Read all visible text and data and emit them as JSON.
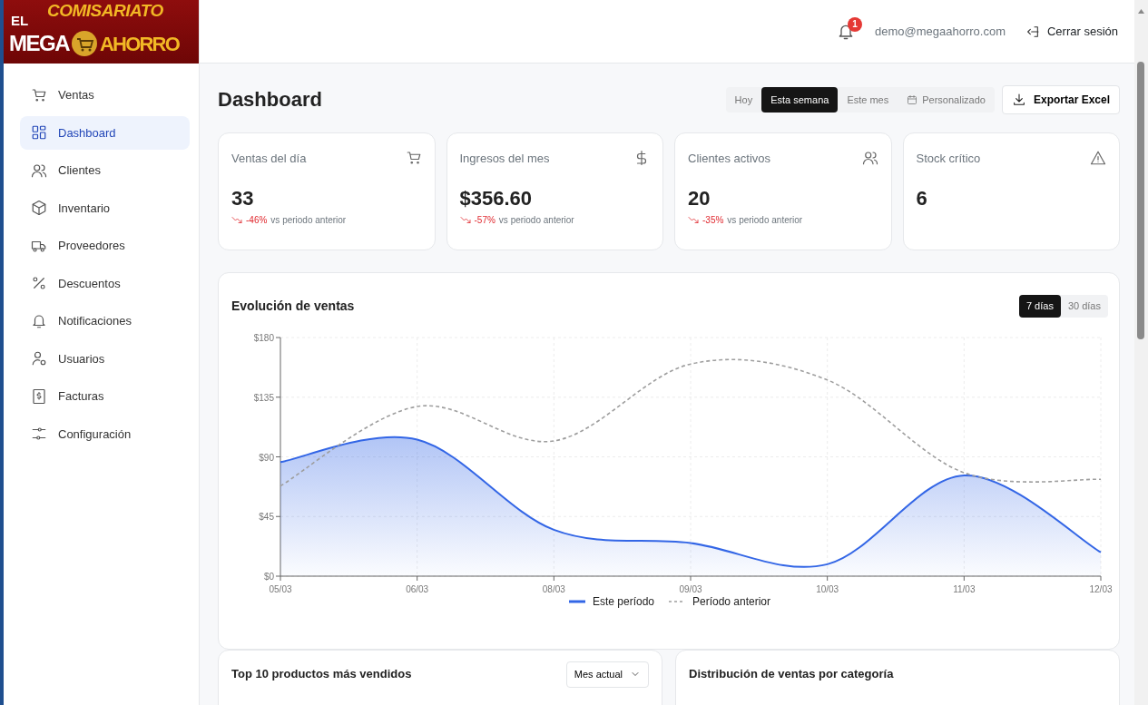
{
  "logo": {
    "texts": [
      "EL",
      "COMISARIATO",
      "MEGA",
      "AHORRO"
    ]
  },
  "header": {
    "notification_count": "1",
    "user_email": "demo@megaahorro.com",
    "logout": "Cerrar sesión"
  },
  "sidebar": {
    "items": [
      {
        "label": "Ventas",
        "selected": false
      },
      {
        "label": "Dashboard",
        "selected": true
      },
      {
        "label": "Clientes",
        "selected": false
      },
      {
        "label": "Inventario",
        "selected": false
      },
      {
        "label": "Proveedores",
        "selected": false
      },
      {
        "label": "Descuentos",
        "selected": false
      },
      {
        "label": "Notificaciones",
        "selected": false
      },
      {
        "label": "Usuarios",
        "selected": false
      },
      {
        "label": "Facturas",
        "selected": false
      },
      {
        "label": "Configuración",
        "selected": false
      }
    ]
  },
  "page": {
    "title": "Dashboard",
    "period_filters": [
      {
        "label": "Hoy",
        "selected": false
      },
      {
        "label": "Esta semana",
        "selected": true
      },
      {
        "label": "Este mes",
        "selected": false
      },
      {
        "label": "Personalizado",
        "selected": false
      }
    ],
    "export_button": "Exportar Excel"
  },
  "stat_cards": [
    {
      "title": "Ventas del día",
      "value": "33",
      "change": "-46%",
      "change_note": "vs periodo anterior"
    },
    {
      "title": "Ingresos del mes",
      "value": "$356.60",
      "change": "-57%",
      "change_note": "vs periodo anterior"
    },
    {
      "title": "Clientes activos",
      "value": "20",
      "change": "-35%",
      "change_note": "vs periodo anterior"
    },
    {
      "title": "Stock crítico",
      "value": "6"
    }
  ],
  "sales_chart": {
    "title": "Evolución de ventas",
    "ranges": [
      {
        "label": "7 días",
        "selected": true
      },
      {
        "label": "30 días",
        "selected": false
      }
    ],
    "chart_data": {
      "type": "area",
      "categories": [
        "05/03",
        "06/03",
        "08/03",
        "09/03",
        "10/03",
        "11/03",
        "12/03"
      ],
      "series": [
        {
          "name": "Este período",
          "type": "area",
          "line_style": "solid",
          "color": "#3366e6",
          "values": [
            86,
            103,
            35,
            25,
            9,
            76,
            18
          ]
        },
        {
          "name": "Período anterior",
          "type": "line",
          "line_style": "dashed",
          "color": "#9e9e9e",
          "values": [
            68,
            128,
            102,
            160,
            148,
            78,
            73
          ]
        }
      ],
      "ylim": [
        0,
        180
      ],
      "grid": true,
      "yticks": [
        {
          "value": 0,
          "label": "$0"
        },
        {
          "value": 45,
          "label": "$45"
        },
        {
          "value": 90,
          "label": "$90"
        },
        {
          "value": 135,
          "label": "$135"
        },
        {
          "value": 180,
          "label": "$180"
        }
      ]
    }
  },
  "bottom_cards": [
    {
      "title": "Top 10 productos más vendidos",
      "dropdown": "Mes actual"
    },
    {
      "title": "Distribución de ventas por categoría"
    }
  ]
}
